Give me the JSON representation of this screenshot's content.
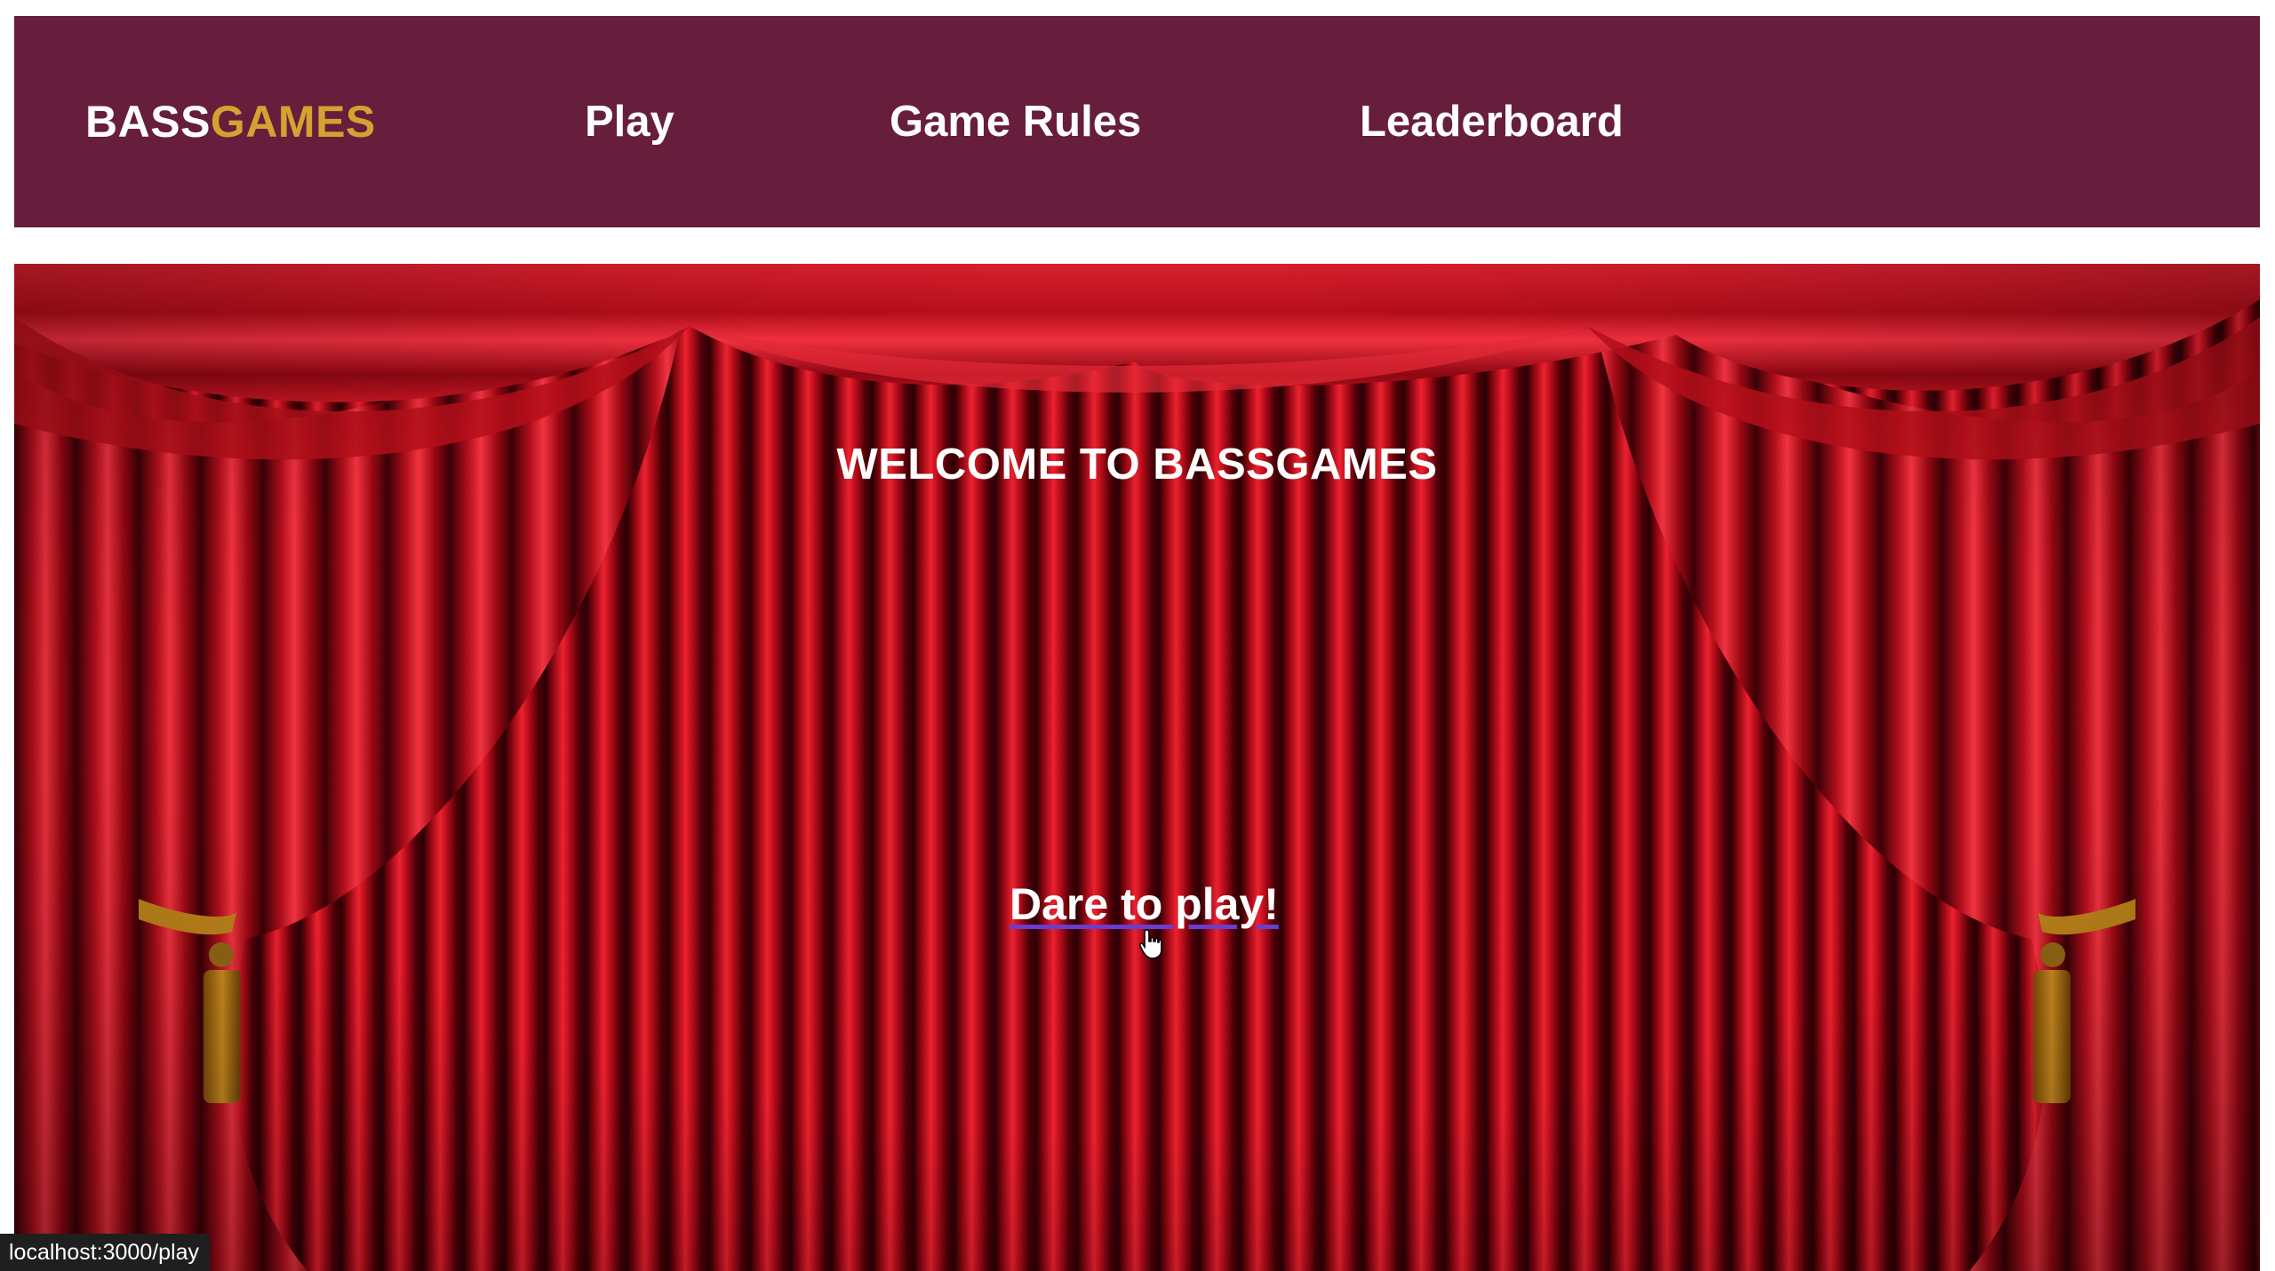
{
  "nav": {
    "brand_primary": "BASS",
    "brand_accent": "GAMES",
    "links": [
      {
        "label": "Play"
      },
      {
        "label": "Game Rules"
      },
      {
        "label": "Leaderboard"
      }
    ]
  },
  "hero": {
    "title": "WELCOME TO BASSGAMES",
    "cta_label": "Dare to play!",
    "background": "red-theater-curtain"
  },
  "status_bar": {
    "url": "localhost:3000/play"
  },
  "colors": {
    "navbar": "#671d3c",
    "brand_accent": "#d4a231",
    "curtain": "#c30d18",
    "text": "#ffffff"
  },
  "icons": {
    "cursor": "hand-pointer-icon"
  }
}
